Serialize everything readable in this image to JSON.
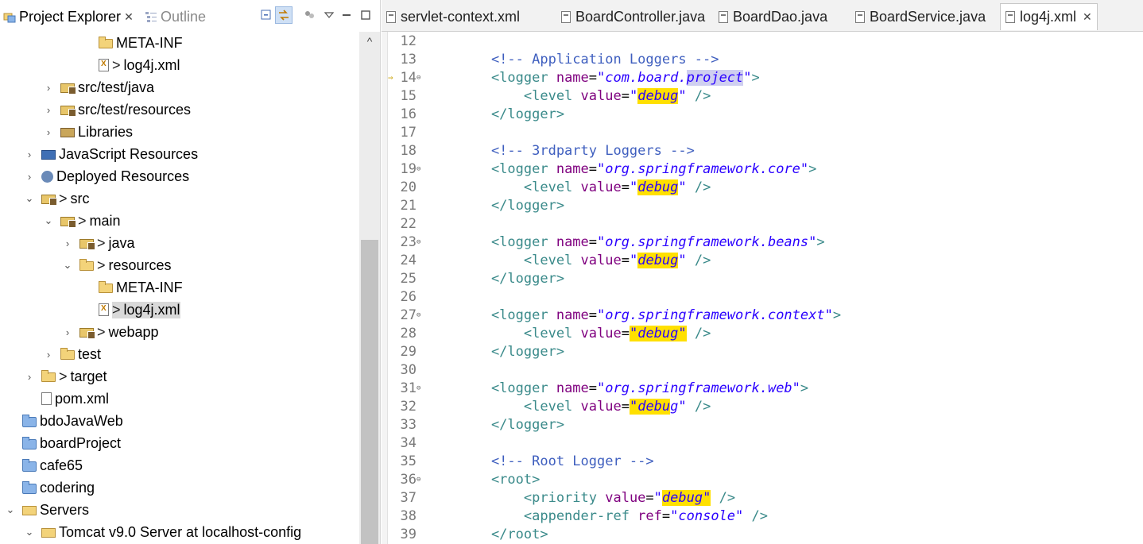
{
  "left_panel": {
    "tabs": [
      {
        "label": "Project Explorer",
        "close": "✕"
      },
      {
        "label": "Outline"
      }
    ],
    "tree": [
      {
        "label": "META-INF",
        "prefix": "",
        "icon": "folder-icon",
        "indent": 102,
        "arrow": ""
      },
      {
        "label": "log4j.xml",
        "prefix": ">",
        "icon": "xml-file-icon",
        "indent": 102,
        "arrow": ""
      },
      {
        "label": "src/test/java",
        "prefix": "",
        "icon": "package-folder-icon",
        "indent": 54,
        "arrow": "›"
      },
      {
        "label": "src/test/resources",
        "prefix": "",
        "icon": "package-folder-icon",
        "indent": 54,
        "arrow": "›"
      },
      {
        "label": "Libraries",
        "prefix": "",
        "icon": "library-icon",
        "indent": 54,
        "arrow": "›"
      },
      {
        "label": "JavaScript Resources",
        "prefix": "",
        "icon": "javascript-icon",
        "indent": 30,
        "arrow": "›"
      },
      {
        "label": "Deployed Resources",
        "prefix": "",
        "icon": "deployed-icon",
        "indent": 30,
        "arrow": "›"
      },
      {
        "label": "src",
        "prefix": ">",
        "icon": "source-folder-icon",
        "indent": 30,
        "arrow": "⌄"
      },
      {
        "label": "main",
        "prefix": ">",
        "icon": "source-folder-icon",
        "indent": 54,
        "arrow": "⌄"
      },
      {
        "label": "java",
        "prefix": ">",
        "icon": "source-folder-icon",
        "indent": 78,
        "arrow": "›"
      },
      {
        "label": "resources",
        "prefix": ">",
        "icon": "folder-open-icon",
        "indent": 78,
        "arrow": "⌄"
      },
      {
        "label": "META-INF",
        "prefix": "",
        "icon": "folder-icon",
        "indent": 102,
        "arrow": ""
      },
      {
        "label": "log4j.xml",
        "prefix": ">",
        "icon": "xml-file-icon",
        "indent": 102,
        "arrow": "",
        "selected": true
      },
      {
        "label": "webapp",
        "prefix": ">",
        "icon": "source-folder-icon",
        "indent": 78,
        "arrow": "›"
      },
      {
        "label": "test",
        "prefix": "",
        "icon": "folder-icon",
        "indent": 54,
        "arrow": "›"
      },
      {
        "label": "target",
        "prefix": ">",
        "icon": "folder-icon",
        "indent": 30,
        "arrow": "›"
      },
      {
        "label": "pom.xml",
        "prefix": "",
        "icon": "maven-file-icon",
        "indent": 30,
        "arrow": ""
      },
      {
        "label": "bdoJavaWeb",
        "prefix": "",
        "icon": "project-icon",
        "indent": 6,
        "arrow": ""
      },
      {
        "label": "boardProject",
        "prefix": "",
        "icon": "project-icon",
        "indent": 6,
        "arrow": ""
      },
      {
        "label": "cafe65",
        "prefix": "",
        "icon": "project-icon",
        "indent": 6,
        "arrow": ""
      },
      {
        "label": "codering",
        "prefix": "",
        "icon": "project-icon",
        "indent": 6,
        "arrow": ""
      },
      {
        "label": "Servers",
        "prefix": "",
        "icon": "servers-folder-icon",
        "indent": 6,
        "arrow": "⌄"
      },
      {
        "label": "Tomcat v9.0 Server at localhost-config",
        "prefix": "",
        "icon": "server-config-icon",
        "indent": 30,
        "arrow": "⌄"
      }
    ]
  },
  "editor": {
    "tabs": [
      {
        "label": "servlet-context.xml"
      },
      {
        "label": "BoardController.java"
      },
      {
        "label": "BoardDao.java"
      },
      {
        "label": "BoardService.java"
      },
      {
        "label": "log4j.xml",
        "active": true,
        "close": "✕"
      }
    ],
    "lines": [
      {
        "num": "12",
        "fold": "",
        "marker": "",
        "parts": []
      },
      {
        "num": "13",
        "fold": "",
        "marker": "",
        "parts": [
          {
            "c": "t-com",
            "t": "    <!-- Application Loggers -->"
          }
        ]
      },
      {
        "num": "14",
        "fold": "⊖",
        "marker": "⇒",
        "parts": [
          {
            "c": "t-tag",
            "t": "    <logger "
          },
          {
            "c": "t-attr",
            "t": "name"
          },
          {
            "c": "t-eq",
            "t": "="
          },
          {
            "c": "t-val",
            "t": "\"com.board."
          },
          {
            "c": "t-val hl-p",
            "t": "project"
          },
          {
            "c": "t-val",
            "t": "\""
          },
          {
            "c": "t-tag",
            "t": ">"
          }
        ]
      },
      {
        "num": "15",
        "fold": "",
        "marker": "",
        "parts": [
          {
            "c": "t-tag",
            "t": "        <level "
          },
          {
            "c": "t-attr",
            "t": "value"
          },
          {
            "c": "t-eq",
            "t": "="
          },
          {
            "c": "t-val",
            "t": "\""
          },
          {
            "c": "t-val hl-y",
            "t": "debug"
          },
          {
            "c": "t-val",
            "t": "\""
          },
          {
            "c": "t-tag",
            "t": " />"
          }
        ]
      },
      {
        "num": "16",
        "fold": "",
        "marker": "",
        "parts": [
          {
            "c": "t-tag",
            "t": "    </logger>"
          }
        ]
      },
      {
        "num": "17",
        "fold": "",
        "marker": "",
        "parts": []
      },
      {
        "num": "18",
        "fold": "",
        "marker": "",
        "parts": [
          {
            "c": "t-com",
            "t": "    <!-- 3rdparty Loggers -->"
          }
        ]
      },
      {
        "num": "19",
        "fold": "⊖",
        "marker": "",
        "parts": [
          {
            "c": "t-tag",
            "t": "    <logger "
          },
          {
            "c": "t-attr",
            "t": "name"
          },
          {
            "c": "t-eq",
            "t": "="
          },
          {
            "c": "t-val",
            "t": "\"org.springframework.core\""
          },
          {
            "c": "t-tag",
            "t": ">"
          }
        ]
      },
      {
        "num": "20",
        "fold": "",
        "marker": "",
        "parts": [
          {
            "c": "t-tag",
            "t": "        <level "
          },
          {
            "c": "t-attr",
            "t": "value"
          },
          {
            "c": "t-eq",
            "t": "="
          },
          {
            "c": "t-val",
            "t": "\""
          },
          {
            "c": "t-val hl-y",
            "t": "debug"
          },
          {
            "c": "t-val",
            "t": "\""
          },
          {
            "c": "t-tag",
            "t": " />"
          }
        ]
      },
      {
        "num": "21",
        "fold": "",
        "marker": "",
        "parts": [
          {
            "c": "t-tag",
            "t": "    </logger>"
          }
        ]
      },
      {
        "num": "22",
        "fold": "",
        "marker": "",
        "parts": []
      },
      {
        "num": "23",
        "fold": "⊖",
        "marker": "",
        "parts": [
          {
            "c": "t-tag",
            "t": "    <logger "
          },
          {
            "c": "t-attr",
            "t": "name"
          },
          {
            "c": "t-eq",
            "t": "="
          },
          {
            "c": "t-val",
            "t": "\"org.springframework.beans\""
          },
          {
            "c": "t-tag",
            "t": ">"
          }
        ]
      },
      {
        "num": "24",
        "fold": "",
        "marker": "",
        "parts": [
          {
            "c": "t-tag",
            "t": "        <level "
          },
          {
            "c": "t-attr",
            "t": "value"
          },
          {
            "c": "t-eq",
            "t": "="
          },
          {
            "c": "t-val",
            "t": "\""
          },
          {
            "c": "t-val hl-y",
            "t": "debug"
          },
          {
            "c": "t-val",
            "t": "\""
          },
          {
            "c": "t-tag",
            "t": " />"
          }
        ]
      },
      {
        "num": "25",
        "fold": "",
        "marker": "",
        "parts": [
          {
            "c": "t-tag",
            "t": "    </logger>"
          }
        ]
      },
      {
        "num": "26",
        "fold": "",
        "marker": "",
        "parts": []
      },
      {
        "num": "27",
        "fold": "⊖",
        "marker": "",
        "parts": [
          {
            "c": "t-tag",
            "t": "    <logger "
          },
          {
            "c": "t-attr",
            "t": "name"
          },
          {
            "c": "t-eq",
            "t": "="
          },
          {
            "c": "t-val",
            "t": "\"org.springframework.context\""
          },
          {
            "c": "t-tag",
            "t": ">"
          }
        ]
      },
      {
        "num": "28",
        "fold": "",
        "marker": "",
        "parts": [
          {
            "c": "t-tag",
            "t": "        <level "
          },
          {
            "c": "t-attr",
            "t": "value"
          },
          {
            "c": "t-eq",
            "t": "="
          },
          {
            "c": "t-val hl-y",
            "t": "\"debug\""
          },
          {
            "c": "t-tag",
            "t": " />"
          }
        ]
      },
      {
        "num": "29",
        "fold": "",
        "marker": "",
        "parts": [
          {
            "c": "t-tag",
            "t": "    </logger>"
          }
        ]
      },
      {
        "num": "30",
        "fold": "",
        "marker": "",
        "parts": []
      },
      {
        "num": "31",
        "fold": "⊖",
        "marker": "",
        "parts": [
          {
            "c": "t-tag",
            "t": "    <logger "
          },
          {
            "c": "t-attr",
            "t": "name"
          },
          {
            "c": "t-eq",
            "t": "="
          },
          {
            "c": "t-val",
            "t": "\"org.springframework.web\""
          },
          {
            "c": "t-tag",
            "t": ">"
          }
        ]
      },
      {
        "num": "32",
        "fold": "",
        "marker": "",
        "parts": [
          {
            "c": "t-tag",
            "t": "        <level "
          },
          {
            "c": "t-attr",
            "t": "value"
          },
          {
            "c": "t-eq",
            "t": "="
          },
          {
            "c": "t-val hl-y",
            "t": "\"debu"
          },
          {
            "c": "t-val",
            "t": "g\""
          },
          {
            "c": "t-tag",
            "t": " />"
          }
        ]
      },
      {
        "num": "33",
        "fold": "",
        "marker": "",
        "parts": [
          {
            "c": "t-tag",
            "t": "    </logger>"
          }
        ]
      },
      {
        "num": "34",
        "fold": "",
        "marker": "",
        "parts": []
      },
      {
        "num": "35",
        "fold": "",
        "marker": "",
        "parts": [
          {
            "c": "t-com",
            "t": "    <!-- Root Logger -->"
          }
        ]
      },
      {
        "num": "36",
        "fold": "⊖",
        "marker": "",
        "parts": [
          {
            "c": "t-tag",
            "t": "    <root>"
          }
        ]
      },
      {
        "num": "37",
        "fold": "",
        "marker": "",
        "parts": [
          {
            "c": "t-tag",
            "t": "        <priority "
          },
          {
            "c": "t-attr",
            "t": "value"
          },
          {
            "c": "t-eq",
            "t": "="
          },
          {
            "c": "t-val",
            "t": "\""
          },
          {
            "c": "t-val hl-y",
            "t": "debug\""
          },
          {
            "c": "t-tag",
            "t": " />"
          }
        ]
      },
      {
        "num": "38",
        "fold": "",
        "marker": "",
        "parts": [
          {
            "c": "t-tag",
            "t": "        <appender-ref "
          },
          {
            "c": "t-attr",
            "t": "ref"
          },
          {
            "c": "t-eq",
            "t": "="
          },
          {
            "c": "t-val",
            "t": "\"console\""
          },
          {
            "c": "t-tag",
            "t": " />"
          }
        ]
      },
      {
        "num": "39",
        "fold": "",
        "marker": "",
        "parts": [
          {
            "c": "t-tag",
            "t": "    </root>"
          }
        ]
      }
    ]
  }
}
